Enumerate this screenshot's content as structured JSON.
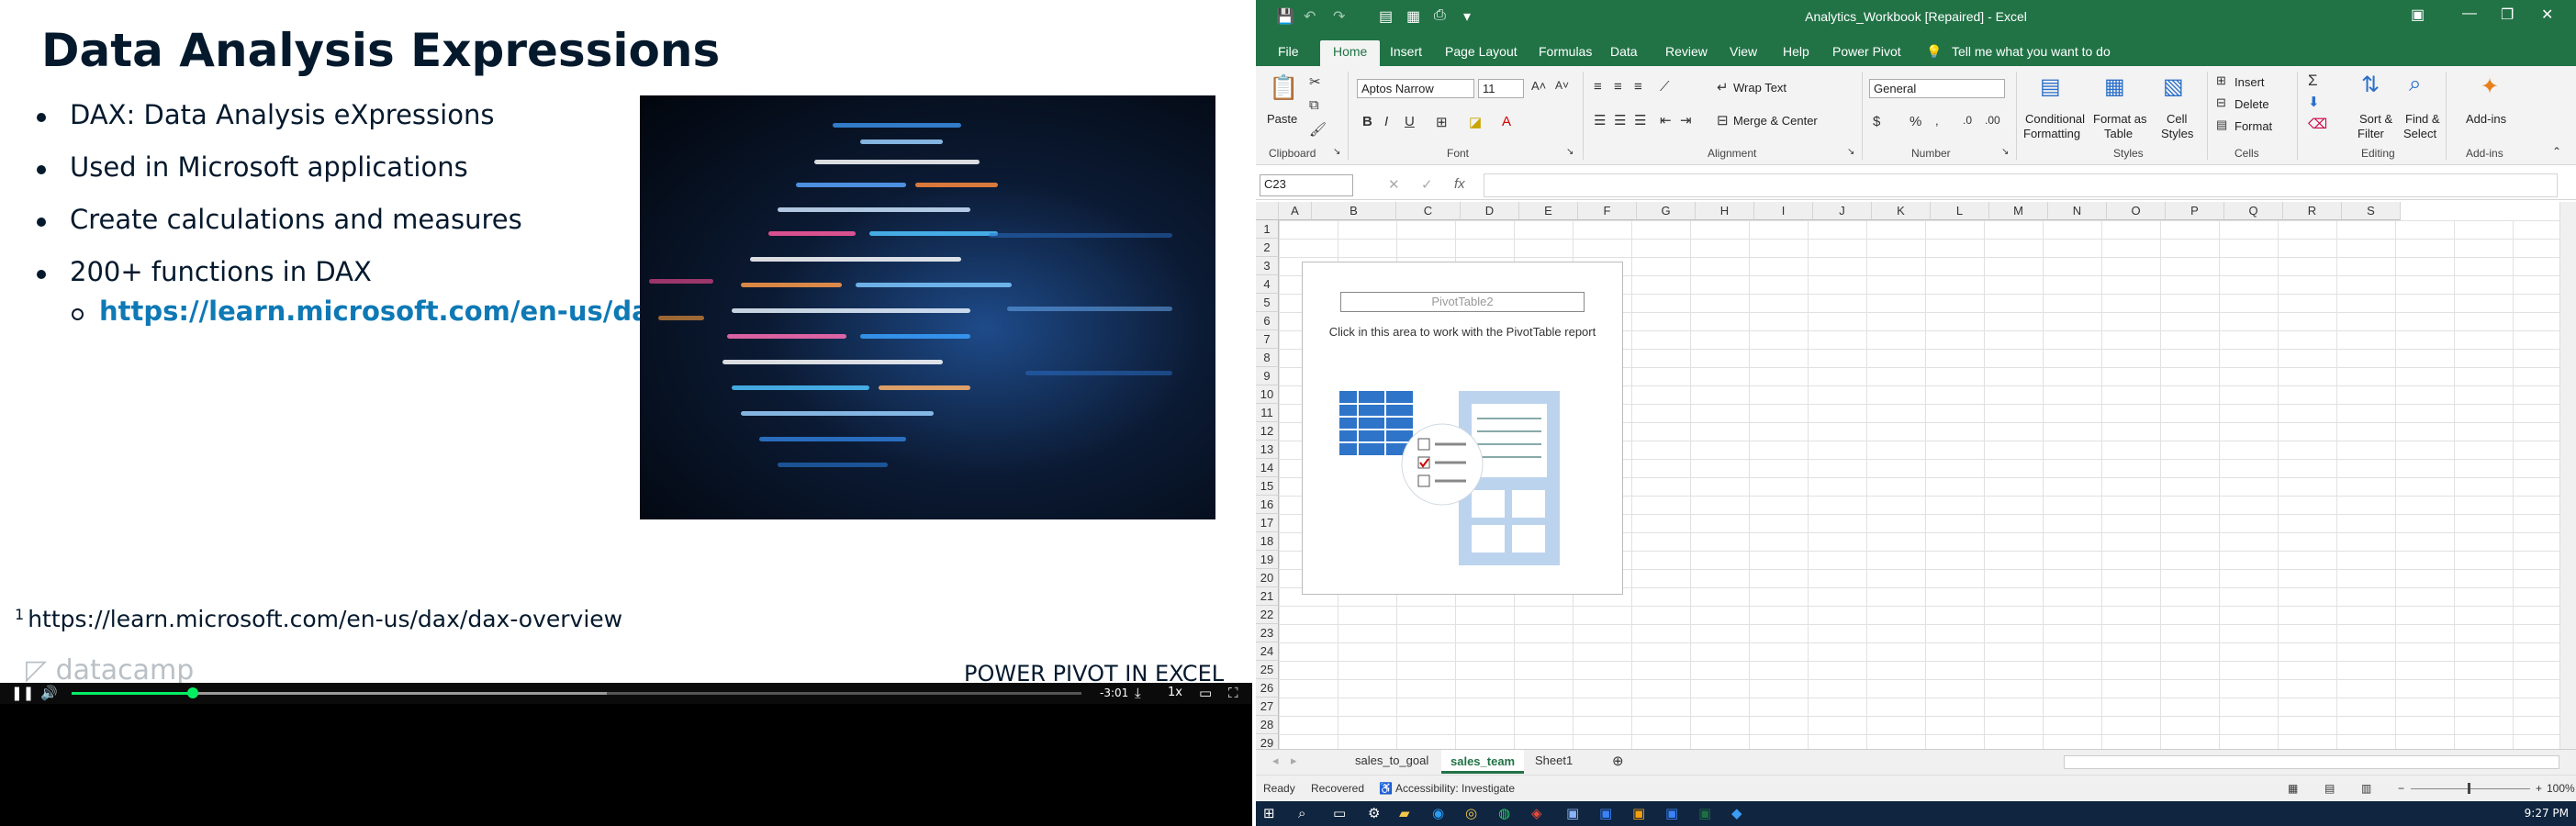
{
  "slide": {
    "title": "Data Analysis Expressions",
    "bullets": [
      "DAX: Data Analysis eXpressions",
      "Used in Microsoft applications",
      "Create calculations and measures",
      "200+ functions in DAX"
    ],
    "sub_link": "https://learn.microsoft.com/en-us/dax/",
    "footnote_number": "1",
    "footnote": "https://learn.microsoft.com/en-us/dax/dax-overview",
    "logo": "datacamp",
    "course_name": "POWER PIVOT IN EXCEL"
  },
  "player": {
    "time_remaining": "-3:01",
    "speed": "1x",
    "progress": 0.12,
    "buffered": 0.53,
    "play_icon": "pause-icon",
    "volume_icon": "volume-icon"
  },
  "excel": {
    "window_title": "Analytics_Workbook [Repaired]  -  Excel",
    "tabs": [
      "File",
      "Home",
      "Insert",
      "Page Layout",
      "Formulas",
      "Data",
      "Review",
      "View",
      "Help",
      "Power Pivot"
    ],
    "tell_me": "Tell me what you want to do",
    "ribbon": {
      "paste": "Paste",
      "font_name": "Aptos Narrow",
      "font_size": "11",
      "wrap_text": "Wrap Text",
      "merge_center": "Merge & Center",
      "number_format": "General",
      "conditional_formatting": [
        "Conditional",
        "Formatting"
      ],
      "format_as_table": [
        "Format as",
        "Table"
      ],
      "cell_styles": [
        "Cell",
        "Styles"
      ],
      "insert": "Insert",
      "delete": "Delete",
      "format": "Format",
      "sort_filter": [
        "Sort &",
        "Filter"
      ],
      "find_select": [
        "Find &",
        "Select"
      ],
      "add_ins": "Add-ins",
      "groups": [
        "Clipboard",
        "Font",
        "Alignment",
        "Number",
        "Styles",
        "Cells",
        "Editing",
        "Add-ins"
      ]
    },
    "name_box": "C23",
    "fx": "fx",
    "columns": [
      "A",
      "B",
      "C",
      "D",
      "E",
      "F",
      "G",
      "H",
      "I",
      "J",
      "K",
      "L",
      "M",
      "N",
      "O",
      "P",
      "Q",
      "R",
      "S"
    ],
    "rows": [
      "1",
      "2",
      "3",
      "4",
      "5",
      "6",
      "7",
      "8",
      "9",
      "10",
      "11",
      "12",
      "13",
      "14",
      "15",
      "16",
      "17",
      "18",
      "19",
      "20",
      "21",
      "22",
      "23",
      "24",
      "25",
      "26",
      "27",
      "28",
      "29"
    ],
    "pivot": {
      "name": "PivotTable2",
      "instruction": "Click in this area to work with the PivotTable report"
    },
    "sheets": [
      "sales_to_goal",
      "sales_team",
      "Sheet1"
    ],
    "active_sheet": "sales_team",
    "status": {
      "ready": "Ready",
      "recovered": "Recovered",
      "accessibility": "Accessibility: Investigate",
      "zoom": "100%"
    }
  },
  "taskbar": {
    "clock": "9:27 PM"
  }
}
